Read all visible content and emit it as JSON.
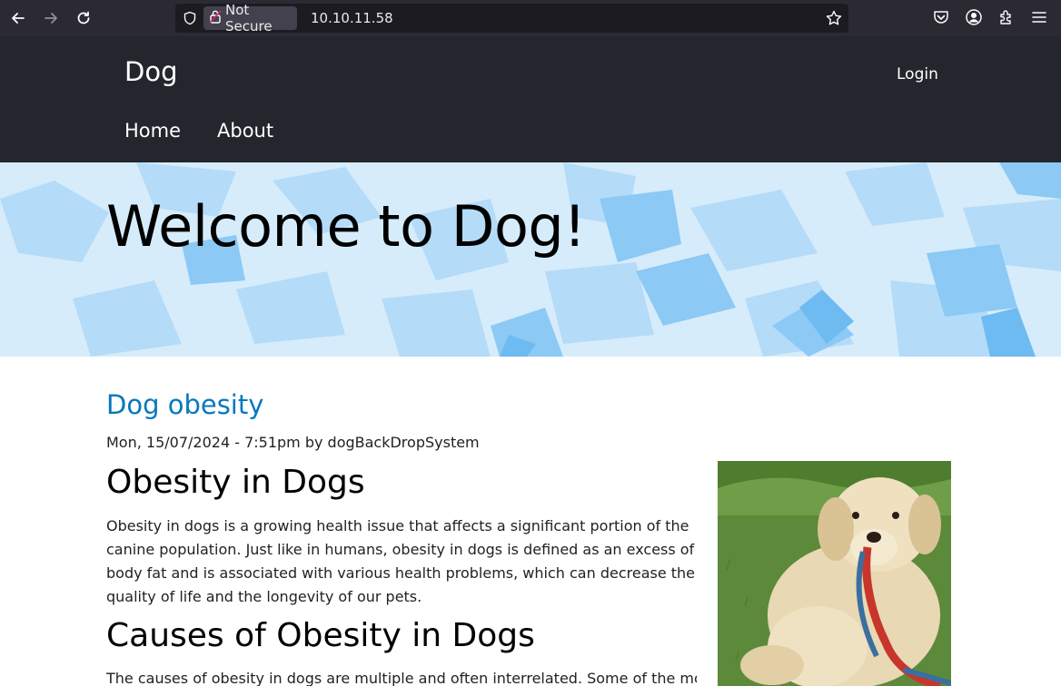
{
  "browser": {
    "security_label": "Not Secure",
    "url": "10.10.11.58"
  },
  "site": {
    "brand": "Dog",
    "login_label": "Login",
    "nav": [
      {
        "label": "Home"
      },
      {
        "label": "About"
      }
    ],
    "hero_title": "Welcome to Dog!"
  },
  "post": {
    "title": "Dog obesity",
    "meta": "Mon, 15/07/2024 - 7:51pm by dogBackDropSystem",
    "heading1": "Obesity in Dogs",
    "paragraph1": "Obesity in dogs is a growing health issue that affects a significant portion of the canine population. Just like in humans, obesity in dogs is defined as an excess of body fat and is associated with various health problems, which can decrease the quality of life and the longevity of our pets.",
    "heading2": "Causes of Obesity in Dogs",
    "paragraph2": "The causes of obesity in dogs are multiple and often interrelated. Some of the most"
  },
  "colors": {
    "header_bg": "#23262d",
    "link": "#0678be",
    "hero_bg": "#cfe9fb"
  }
}
